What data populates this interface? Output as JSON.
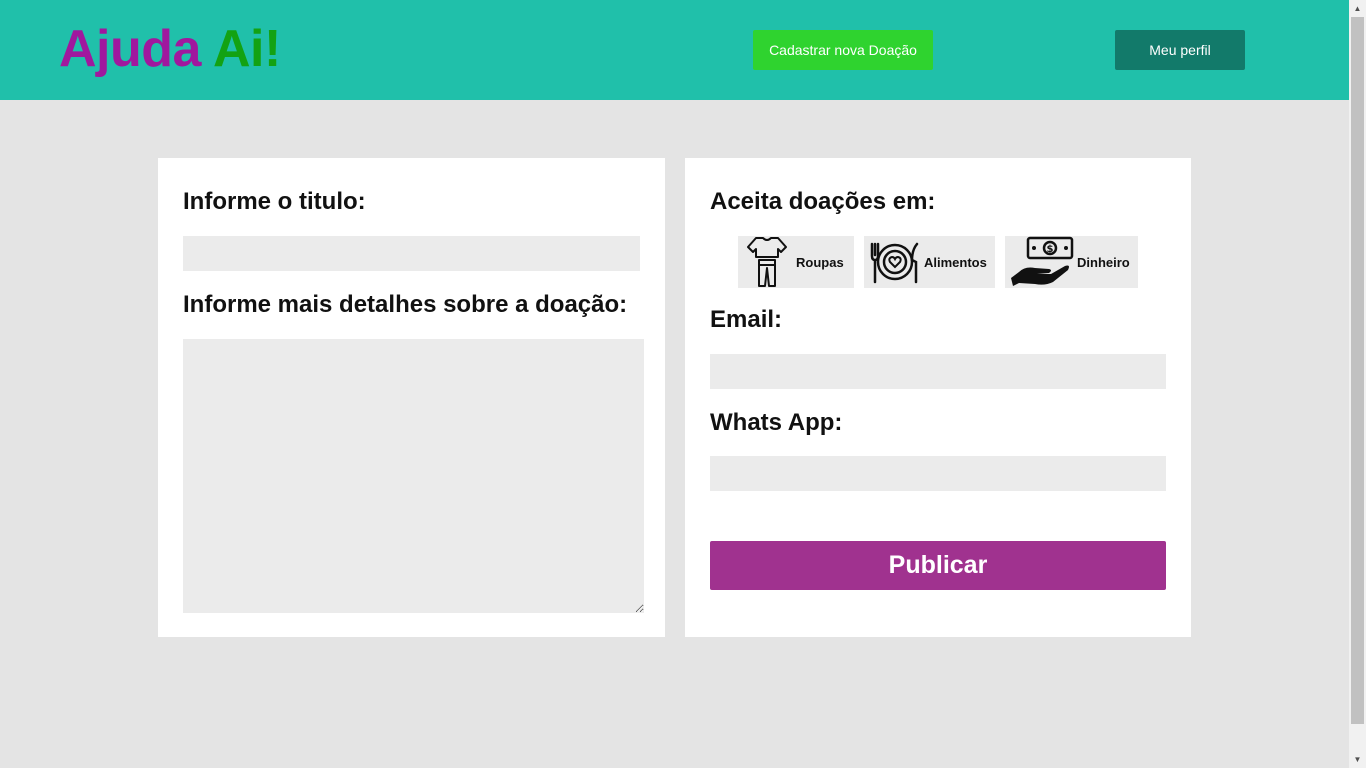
{
  "header": {
    "logo_part1": "Ajuda",
    "logo_part2": "Ai!",
    "new_donation_label": "Cadastrar nova Doação",
    "profile_label": "Meu perfil",
    "colors": {
      "bar": "#20c0aa",
      "logo_part1": "#a0189e",
      "logo_part2": "#13a213",
      "new_donation_button": "#2fd32f",
      "profile_button": "#127a6a"
    }
  },
  "form": {
    "title_label": "Informe o titulo:",
    "title_value": "",
    "details_label": "Informe mais detalhes sobre a doação:",
    "details_value": "",
    "accepts_label": "Aceita doações em:",
    "options": [
      {
        "label": "Roupas",
        "icon": "clothes-icon"
      },
      {
        "label": "Alimentos",
        "icon": "food-plate-icon"
      },
      {
        "label": "Dinheiro",
        "icon": "money-hand-icon"
      }
    ],
    "email_label": "Email:",
    "email_value": "",
    "whatsapp_label": "Whats App:",
    "whatsapp_value": "",
    "publish_label": "Publicar",
    "colors": {
      "publish_button": "#a0328f",
      "input_bg": "#ebebeb"
    }
  }
}
